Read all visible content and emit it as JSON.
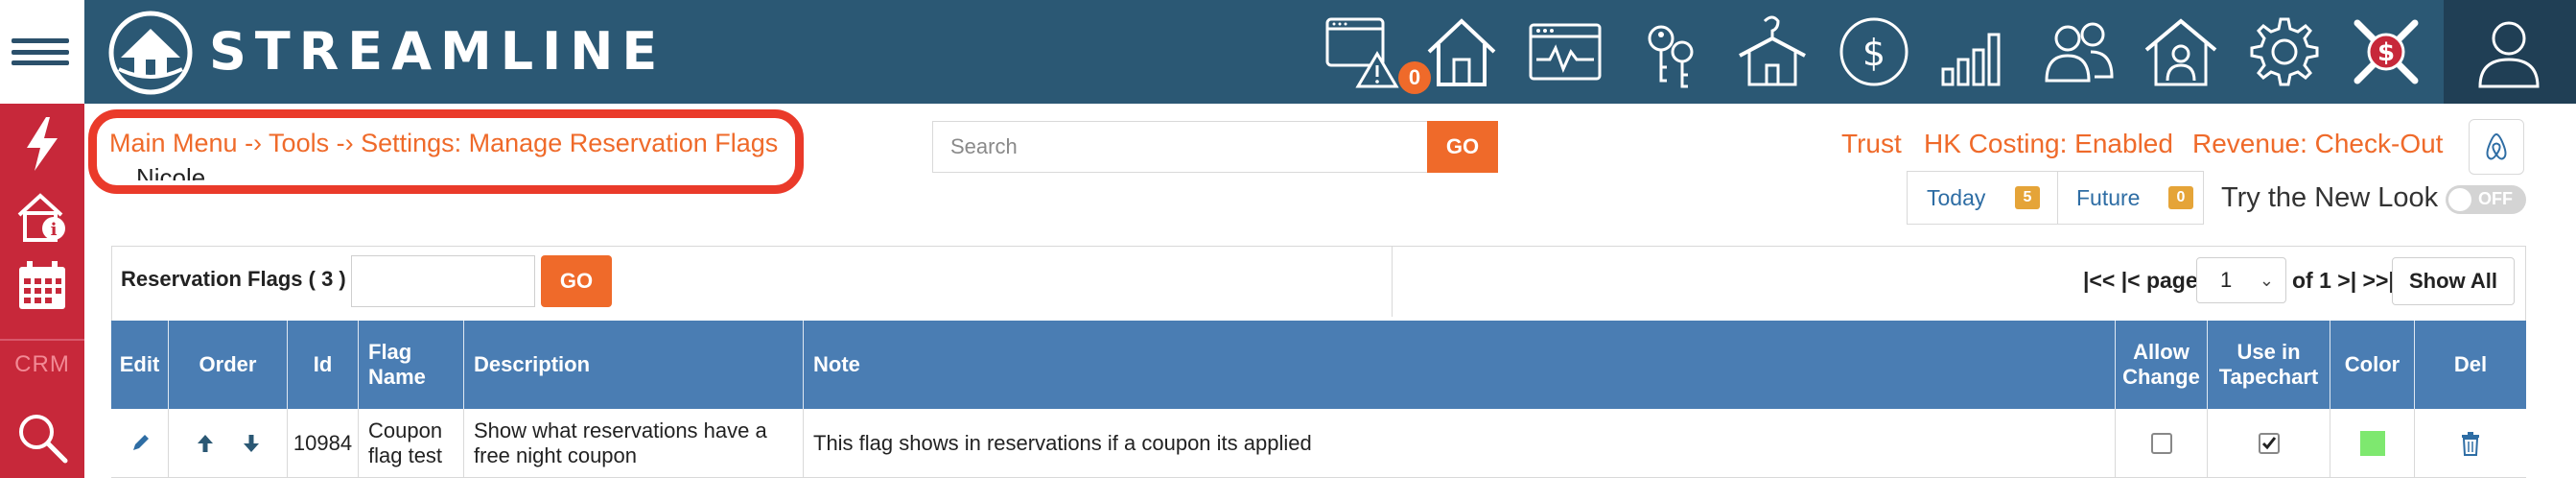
{
  "app": {
    "brand": "STREAMLINE"
  },
  "nav": {
    "icons": [
      "alerts-icon",
      "home-icon",
      "dashboard-icon",
      "keys-icon",
      "housekeeping-icon",
      "dollar-icon",
      "reports-icon",
      "owners-icon",
      "property-icon",
      "settings-icon",
      "tools-icon",
      "user-icon"
    ],
    "alert_count": "0",
    "rail_crm_label": "CRM"
  },
  "breadcrumb": {
    "text": "Main Menu -› Tools -› Settings: Manage Reservation Flags",
    "sub": "Nicole"
  },
  "search": {
    "placeholder": "Search",
    "go_label": "GO"
  },
  "status": {
    "trust": "Trust",
    "hk_costing": "HK Costing: Enabled",
    "revenue": "Revenue: Check-Out",
    "today_label": "Today",
    "today_count": "5",
    "future_label": "Future",
    "future_count": "0",
    "new_look_label": "Try the New Look",
    "toggle_state": "OFF"
  },
  "table_controls": {
    "title": "Reservation Flags ( 3 )",
    "go_label": "GO",
    "pager_prefix": "|<< |< page",
    "page_value": "1",
    "pager_suffix": "of 1 >| >>|",
    "show_all": "Show All"
  },
  "table": {
    "columns": [
      "Edit",
      "Order",
      "Id",
      "Flag Name",
      "Description",
      "Note",
      "Allow Change",
      "Use in Tapechart",
      "Color",
      "Del"
    ],
    "rows": [
      {
        "id": "10984",
        "flag_name": "Coupon flag test",
        "description": "Show what reservations have a free night coupon",
        "note": "This flag shows in reservations if a coupon its applied",
        "allow_change": false,
        "use_in_tapechart": true,
        "color": "#7ee86f"
      }
    ]
  },
  "colors": {
    "topbar": "#2b5874",
    "rail": "#c7283a",
    "accent": "#ef6a2a",
    "table_header": "#4a7db3"
  }
}
